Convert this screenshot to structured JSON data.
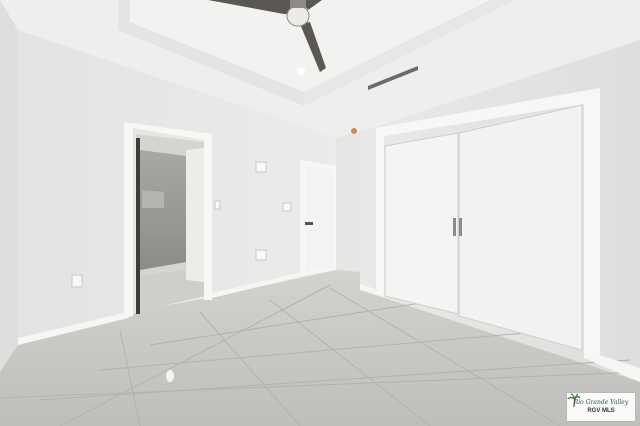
{
  "photo": {
    "subject": "empty-bedroom-interior",
    "colors": {
      "wall": "#e8e8e6",
      "ceiling": "#f0f0ee",
      "floor_tile": "#c9c8c5",
      "door": "#f4f4f2",
      "baseboard": "#f5f5f3",
      "fan_blade": "#5a5754"
    }
  },
  "watermark": {
    "line1": "Rio Grande Valley",
    "line2": "RGV MLS",
    "logo_icon": "palm-tree-icon"
  }
}
